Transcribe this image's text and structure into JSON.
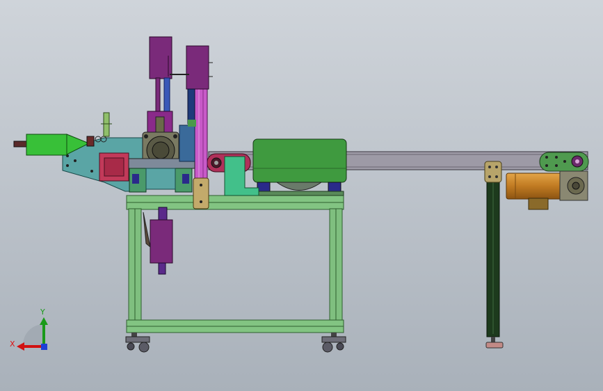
{
  "viewport": {
    "background_top": "#cfd4da",
    "background_bottom": "#a9b1ba"
  },
  "triad": {
    "x_label": "X",
    "y_label": "Y",
    "x_color": "#d11111",
    "y_color": "#1a9a1a",
    "z_color": "#1e3fd6"
  },
  "colors": {
    "frame_green": "#7fbf7f",
    "frame_edge": "#2e5e2e",
    "purple": "#7a2a7a",
    "magenta": "#c85ac8",
    "teal": "#5aa5a5",
    "conveyor_gray": "#9d9aa6",
    "motor_green": "#3f9a3f",
    "crimson": "#b0305a",
    "khaki": "#b7a46a",
    "bronze": "#c8862c",
    "olive_gray": "#6f6a4e",
    "dark_column": "#1d3a1d",
    "bright_green": "#38c038"
  }
}
